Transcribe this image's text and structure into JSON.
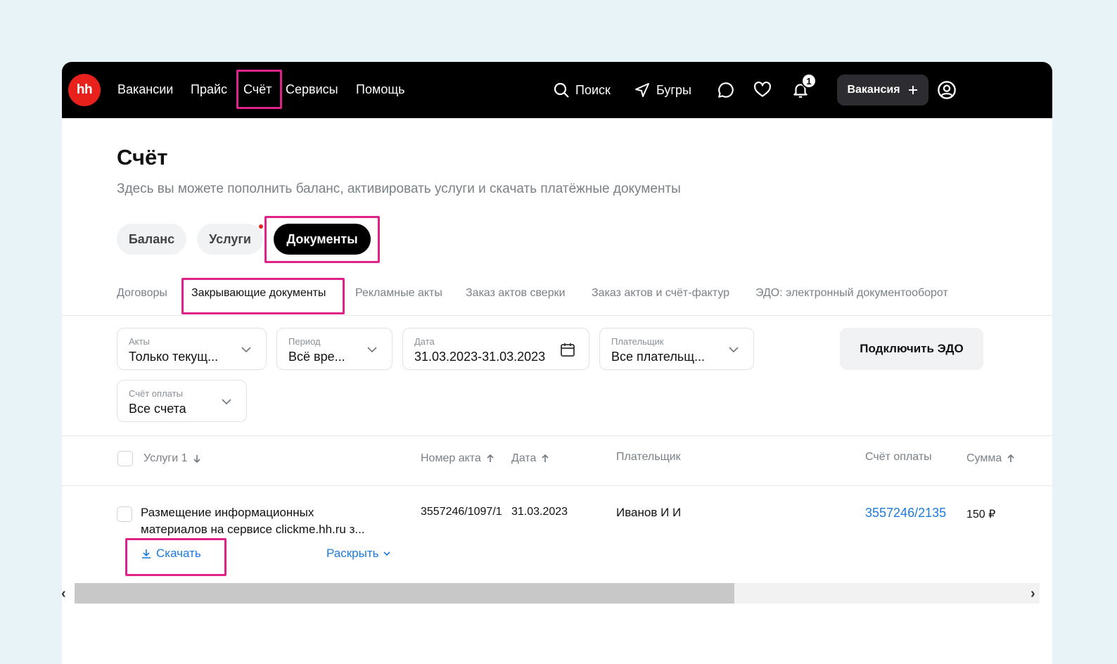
{
  "nav": {
    "logo": "hh",
    "items": [
      "Вакансии",
      "Прайс",
      "Счёт",
      "Сервисы",
      "Помощь"
    ],
    "search_label": "Поиск",
    "location_label": "Бугры",
    "notifications_count": "1",
    "vacancy_button": "Вакансия"
  },
  "page": {
    "title": "Счёт",
    "subtitle": "Здесь вы можете пополнить баланс, активировать услуги и скачать платёжные документы"
  },
  "main_tabs": [
    "Баланс",
    "Услуги",
    "Документы"
  ],
  "sub_tabs": [
    "Договоры",
    "Закрывающие документы",
    "Рекламные акты",
    "Заказ актов сверки",
    "Заказ актов и счёт-фактур",
    "ЭДО: электронный документооборот"
  ],
  "filters": {
    "acts": {
      "label": "Акты",
      "value": "Только текущ..."
    },
    "period": {
      "label": "Период",
      "value": "Всё вре..."
    },
    "date": {
      "label": "Дата",
      "value": "31.03.2023-31.03.2023"
    },
    "payer": {
      "label": "Плательщик",
      "value": "Все плательщ..."
    },
    "account": {
      "label": "Счёт оплаты",
      "value": "Все счета"
    },
    "edo_button": "Подключить ЭДО"
  },
  "table": {
    "headers": {
      "services": "Услуги 1",
      "act_number": "Номер акта",
      "date": "Дата",
      "payer": "Плательщик",
      "account": "Счёт оплаты",
      "sum": "Сумма"
    },
    "rows": [
      {
        "service_line1": "Размещение информационных",
        "service_line2": "материалов на сервисе clickme.hh.ru з...",
        "act_number": "3557246/1097/1",
        "date": "31.03.2023",
        "payer": "Иванов И И",
        "account": "3557246/2135",
        "sum": "150 ₽",
        "download": "Скачать",
        "expand": "Раскрыть"
      }
    ]
  },
  "colors": {
    "highlight": "#e0218a",
    "link": "#1d7adf",
    "logo": "#e8211d"
  }
}
